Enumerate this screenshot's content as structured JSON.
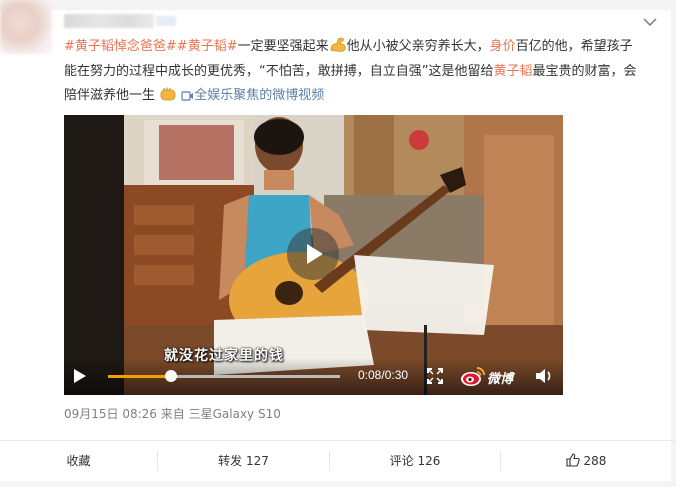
{
  "post": {
    "author_name": "",
    "text_segments": [
      {
        "text": "#黄子韬悼念爸爸#",
        "style": "link"
      },
      {
        "text": "黄子韬",
        "style": "link",
        "prefix": "#",
        "suffix": "#"
      },
      {
        "text": "一定要坚强起来",
        "style": "plain"
      },
      {
        "text": "他从小被父亲穷养长大，",
        "style": "plain"
      },
      {
        "text": "身价",
        "style": "link"
      },
      {
        "text": "百亿的他，希望孩子能在努力的过程中成长的更优秀，“不怕苦，敢拼搏，自立自强”这是他留给",
        "style": "plain"
      },
      {
        "text": "黄子韬",
        "style": "link"
      },
      {
        "text": "最宝贵的财富，会陪伴滋养他一生",
        "style": "plain"
      },
      {
        "text": "全娱乐聚焦的微博视频",
        "style": "blue"
      }
    ],
    "video_link_label": "全娱乐聚焦的微博视频",
    "emoji_1": "flexed-biceps-emoji",
    "emoji_2": "fist-emoji"
  },
  "video": {
    "subtitle": "就没花过家里的钱",
    "current_time": "0:08",
    "duration": "0:30",
    "time_display": "0:08/0:30",
    "progress_fraction": 0.27,
    "watermark_text": "微博",
    "controls": {
      "play_icon": "play-icon",
      "fullscreen_icon": "fullscreen-icon",
      "volume_icon": "volume-icon",
      "logo_icon": "weibo-logo-icon"
    }
  },
  "meta": {
    "timestamp": "09月15日 08:26",
    "source_prefix": "来自",
    "source_device": "三星Galaxy S10"
  },
  "actions": {
    "favorite_label": "收藏",
    "repost_label": "转发",
    "repost_count": "127",
    "comment_label": "评论",
    "comment_count": "126",
    "like_count": "288"
  },
  "colors": {
    "link": "#eb7350",
    "blue_link": "#5d7fa8",
    "progress": "#f0a000",
    "meta_text": "#808080"
  }
}
